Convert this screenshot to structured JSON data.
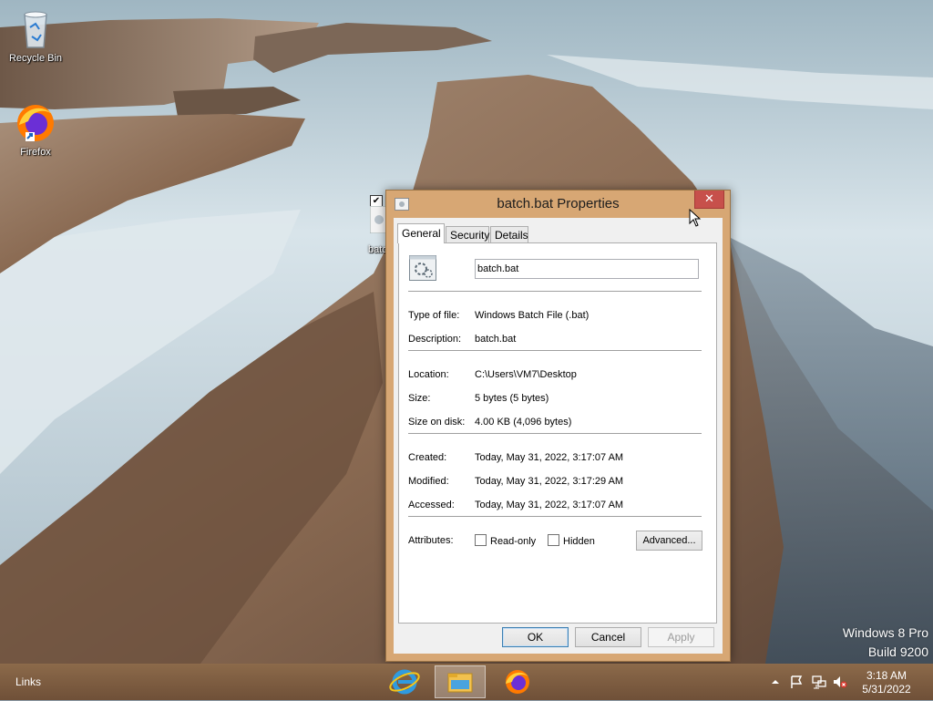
{
  "desktop": {
    "icons": [
      {
        "label": "Recycle Bin",
        "icon": "recycle-bin-icon"
      },
      {
        "label": "Firefox",
        "icon": "firefox-icon"
      },
      {
        "label": "batc",
        "icon": "batch-file-icon"
      }
    ],
    "watermark": {
      "line1": "Windows 8 Pro",
      "line2": "Build 9200"
    }
  },
  "dialog": {
    "title": "batch.bat Properties",
    "close_glyph": "✕",
    "tabs": [
      {
        "label": "General",
        "active": true
      },
      {
        "label": "Security",
        "active": false
      },
      {
        "label": "Details",
        "active": false
      }
    ],
    "file_name": "batch.bat",
    "fields": {
      "type_label": "Type of file:",
      "type_value": "Windows Batch File (.bat)",
      "description_label": "Description:",
      "description_value": "batch.bat",
      "location_label": "Location:",
      "location_value": "C:\\Users\\VM7\\Desktop",
      "size_label": "Size:",
      "size_value": "5 bytes (5 bytes)",
      "size_on_disk_label": "Size on disk:",
      "size_on_disk_value": "4.00 KB (4,096 bytes)",
      "created_label": "Created:",
      "created_value": "Today, May 31, 2022, 3:17:07 AM",
      "modified_label": "Modified:",
      "modified_value": "Today, May 31, 2022, 3:17:29 AM",
      "accessed_label": "Accessed:",
      "accessed_value": "Today, May 31, 2022, 3:17:07 AM",
      "attributes_label": "Attributes:"
    },
    "attributes": {
      "read_only_label": "Read-only",
      "read_only_checked": false,
      "hidden_label": "Hidden",
      "hidden_checked": false,
      "advanced_label": "Advanced..."
    },
    "buttons": {
      "ok": "OK",
      "cancel": "Cancel",
      "apply": "Apply"
    }
  },
  "taskbar": {
    "links_label": "Links",
    "pinned": [
      "internet-explorer-icon",
      "file-explorer-icon",
      "firefox-icon"
    ],
    "tray": {
      "time": "3:18 AM",
      "date": "5/31/2022"
    },
    "colors": {
      "taskbar": "#7d5c41",
      "dialog_frame": "#d7a774",
      "close_button": "#c7504b"
    }
  }
}
